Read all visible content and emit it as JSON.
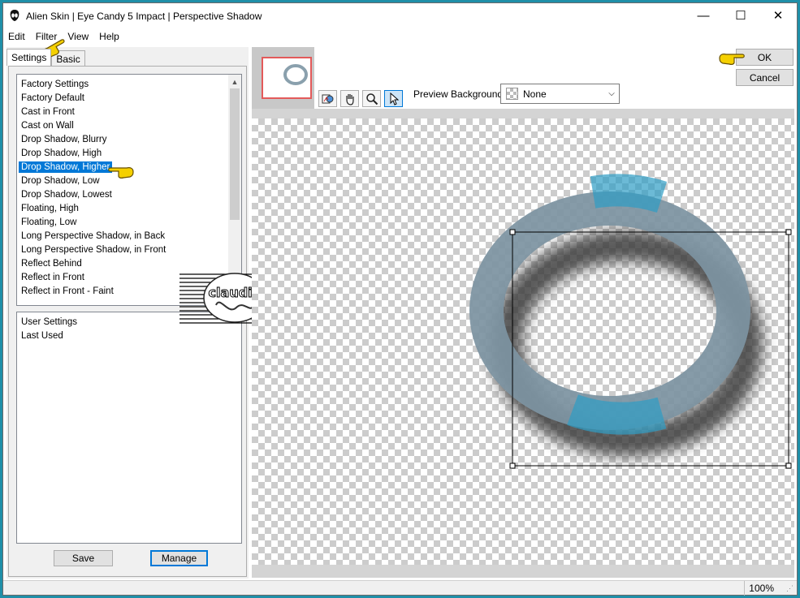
{
  "window": {
    "title": "Alien Skin | Eye Candy 5 Impact | Perspective Shadow",
    "minimize": "—",
    "maximize": "☐",
    "close": "✕"
  },
  "menu": [
    "Edit",
    "Filter",
    "View",
    "Help"
  ],
  "tabs": [
    {
      "label": "Settings",
      "active": true
    },
    {
      "label": "Basic",
      "active": false
    }
  ],
  "factory_settings": {
    "header": "Factory Settings",
    "items": [
      "Factory Default",
      "Cast in Front",
      "Cast on Wall",
      "Drop Shadow, Blurry",
      "Drop Shadow, High",
      "Drop Shadow, Higher",
      "Drop Shadow, Low",
      "Drop Shadow, Lowest",
      "Floating, High",
      "Floating, Low",
      "Long Perspective Shadow, in Back",
      "Long Perspective Shadow, in Front",
      "Reflect Behind",
      "Reflect in Front",
      "Reflect in Front - Faint"
    ],
    "selected": "Drop Shadow, Higher"
  },
  "user_settings": {
    "header": "User Settings",
    "items": [
      "Last Used"
    ]
  },
  "buttons": {
    "save": "Save",
    "manage": "Manage",
    "ok": "OK",
    "cancel": "Cancel"
  },
  "toolbar": {
    "icons": [
      "preview-toggle-icon",
      "hand-icon",
      "zoom-icon",
      "arrow-pointer-icon"
    ],
    "active": "arrow-pointer-icon"
  },
  "preview_background": {
    "label": "Preview Background:",
    "value": "None"
  },
  "watermark_text": "claudia",
  "status": {
    "zoom": "100%"
  },
  "colors": {
    "outer_frame": "#1f8fa8",
    "selection": "#0078d7",
    "ring": "#7f95a3",
    "ring_accent": "#2e9cc4",
    "pointer": "#f5d000"
  }
}
